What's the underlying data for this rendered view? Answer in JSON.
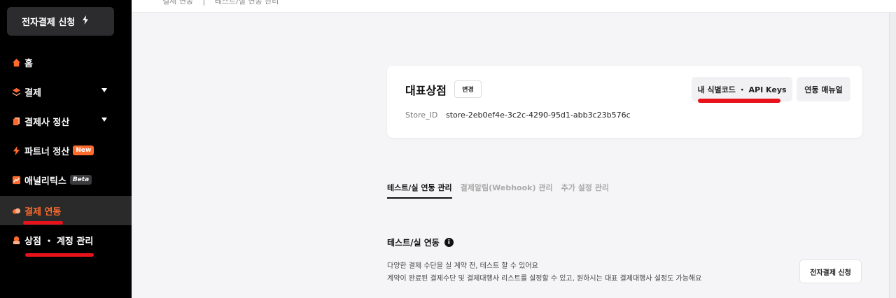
{
  "sidebar": {
    "apply_label": "전자결제 신청",
    "items": [
      {
        "label": "홈",
        "icon": "home-icon"
      },
      {
        "label": "결제",
        "icon": "layers-icon"
      },
      {
        "label": "결제사 정산",
        "icon": "documents-icon"
      },
      {
        "label": "파트너 정산",
        "icon": "bolt-icon",
        "badge": "New"
      },
      {
        "label": "애널리틱스",
        "icon": "chart-icon",
        "badge": "Beta"
      },
      {
        "label": "결제 연동",
        "icon": "cloud-icon"
      },
      {
        "label": "상점 ・ 계정 관리",
        "icon": "store-icon"
      }
    ],
    "active_index": 5
  },
  "breadcrumb": [
    "결제 연동",
    "테스트/실 연동 관리"
  ],
  "store_card": {
    "name": "대표상점",
    "change_label": "변경",
    "store_id_label": "Store_ID",
    "store_id_value": "store-2eb0ef4e-3c2c-4290-95d1-abb3c23b576c",
    "keys_label": "내 식별코드 ・ API Keys",
    "manual_label": "연동 매뉴얼"
  },
  "tabs": [
    {
      "label": "테스트/실 연동 관리",
      "active": true
    },
    {
      "label": "결제알림(Webhook) 관리",
      "active": false
    },
    {
      "label": "추가 설정 관리",
      "active": false
    }
  ],
  "section": {
    "title": "테스트/실 연동",
    "info_icon": "i",
    "desc1": "다양한 결제 수단을 실 계약 전, 테스트 할 수 있어요",
    "desc2": "계약이 완료된 결제수단 및 결제대행사 리스트를 설정할 수 있고, 원하시는 대표 결제대행사 설정도 가능해요",
    "apply_label": "전자결제 신청"
  },
  "colors": {
    "accent": "#ff6b2c",
    "annotation": "#e8121a",
    "sidebar_bg": "#000000"
  }
}
